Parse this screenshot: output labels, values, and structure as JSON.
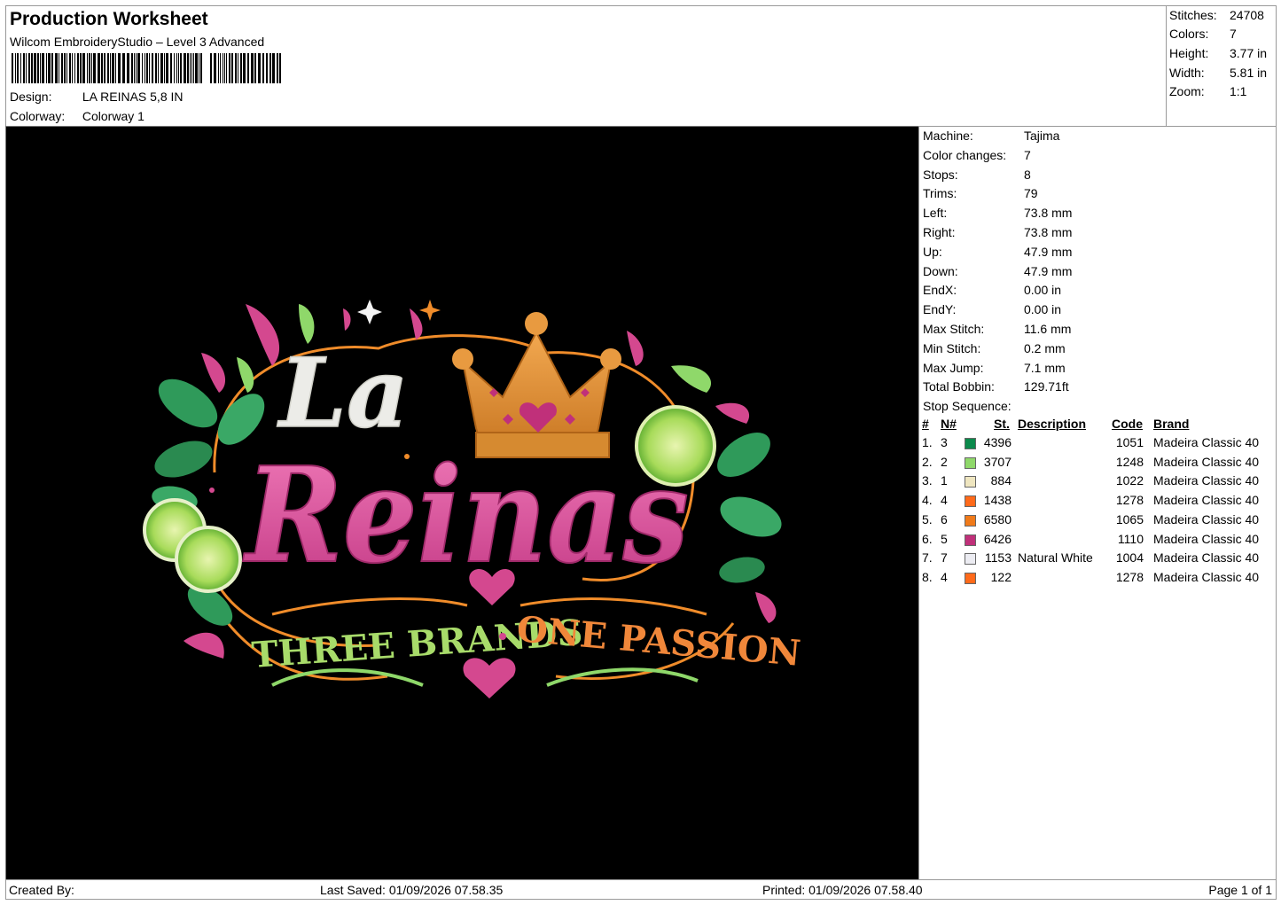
{
  "header": {
    "title": "Production Worksheet",
    "software": "Wilcom EmbroideryStudio – Level 3 Advanced",
    "design_label": "Design:",
    "design_value": "LA REINAS 5,8 IN",
    "colorway_label": "Colorway:",
    "colorway_value": "Colorway 1"
  },
  "stats": [
    {
      "label": "Stitches:",
      "value": "24708"
    },
    {
      "label": "Colors:",
      "value": "7"
    },
    {
      "label": "Height:",
      "value": "3.77 in"
    },
    {
      "label": "Width:",
      "value": "5.81 in"
    },
    {
      "label": "Zoom:",
      "value": "1:1"
    }
  ],
  "properties": [
    {
      "label": "Machine:",
      "value": "Tajima"
    },
    {
      "label": "Color changes:",
      "value": "7"
    },
    {
      "label": "Stops:",
      "value": "8"
    },
    {
      "label": "Trims:",
      "value": "79"
    },
    {
      "label": "Left:",
      "value": "73.8 mm"
    },
    {
      "label": "Right:",
      "value": "73.8 mm"
    },
    {
      "label": "Up:",
      "value": "47.9 mm"
    },
    {
      "label": "Down:",
      "value": "47.9 mm"
    },
    {
      "label": "EndX:",
      "value": "0.00 in"
    },
    {
      "label": "EndY:",
      "value": "0.00 in"
    },
    {
      "label": "Max Stitch:",
      "value": "11.6 mm"
    },
    {
      "label": "Min Stitch:",
      "value": "0.2 mm"
    },
    {
      "label": "Max Jump:",
      "value": "7.1 mm"
    },
    {
      "label": "Total Bobbin:",
      "value": "129.71ft"
    },
    {
      "label": "Stop Sequence:",
      "value": ""
    }
  ],
  "stop_table": {
    "headers": {
      "idx": "#",
      "n": "N#",
      "st": "St.",
      "desc": "Description",
      "code": "Code",
      "brand": "Brand"
    },
    "rows": [
      {
        "idx": "1.",
        "n": "3",
        "color": "#0b8a4c",
        "st": "4396",
        "desc": "",
        "code": "1051",
        "brand": "Madeira Classic 40"
      },
      {
        "idx": "2.",
        "n": "2",
        "color": "#8fd86a",
        "st": "3707",
        "desc": "",
        "code": "1248",
        "brand": "Madeira Classic 40"
      },
      {
        "idx": "3.",
        "n": "1",
        "color": "#efe6c0",
        "st": "884",
        "desc": "",
        "code": "1022",
        "brand": "Madeira Classic 40"
      },
      {
        "idx": "4.",
        "n": "4",
        "color": "#ff6a1a",
        "st": "1438",
        "desc": "",
        "code": "1278",
        "brand": "Madeira Classic 40"
      },
      {
        "idx": "5.",
        "n": "6",
        "color": "#f07a1a",
        "st": "6580",
        "desc": "",
        "code": "1065",
        "brand": "Madeira Classic 40"
      },
      {
        "idx": "6.",
        "n": "5",
        "color": "#c0307a",
        "st": "6426",
        "desc": "",
        "code": "1110",
        "brand": "Madeira Classic 40"
      },
      {
        "idx": "7.",
        "n": "7",
        "color": "#ececf2",
        "st": "1153",
        "desc": "Natural White",
        "code": "1004",
        "brand": "Madeira Classic 40"
      },
      {
        "idx": "8.",
        "n": "4",
        "color": "#ff6a1a",
        "st": "122",
        "desc": "",
        "code": "1278",
        "brand": "Madeira Classic 40"
      }
    ]
  },
  "design_art": {
    "line1": "La",
    "line2": "Reinas",
    "tagline_left": "THREE BRANDS",
    "tagline_right": "ONE PASSION"
  },
  "footer": {
    "created_by": "Created By:",
    "last_saved": "Last Saved: 01/09/2026 07.58.35",
    "printed": "Printed: 01/09/2026 07.58.40",
    "page": "Page 1 of 1"
  }
}
